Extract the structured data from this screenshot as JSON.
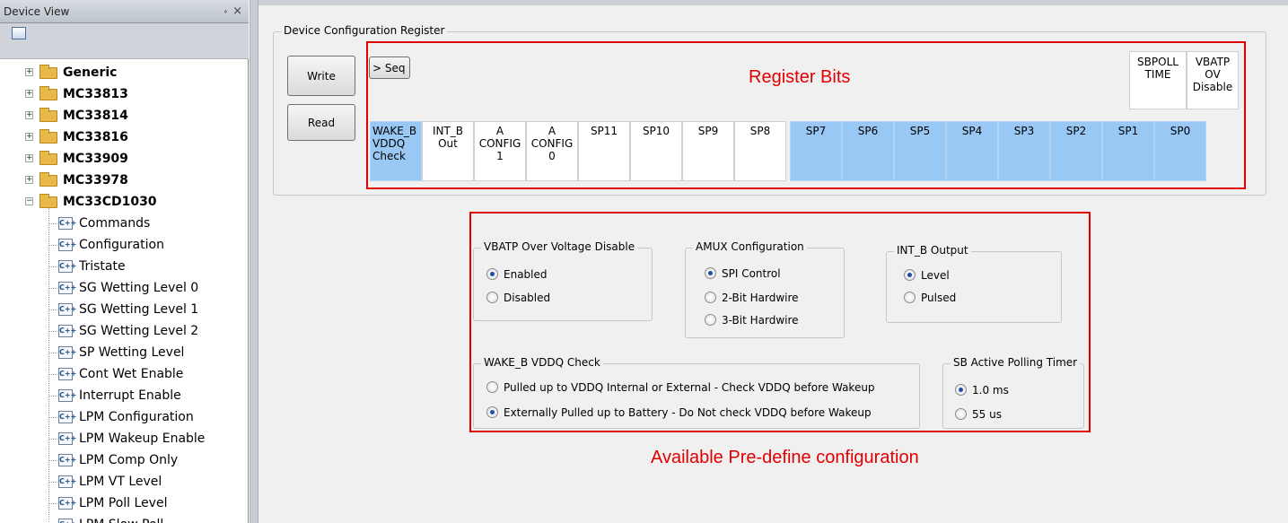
{
  "device_view": {
    "title": "Device View",
    "pin_glyph": "⬫",
    "close_glyph": "×",
    "collapsed_folders": [
      "Generic",
      "MC33813",
      "MC33814",
      "MC33816",
      "MC33909",
      "MC33978"
    ],
    "expanded_folder": "MC33CD1030",
    "children": [
      "Commands",
      "Configuration",
      "Tristate",
      "SG Wetting Level 0",
      "SG Wetting Level 1",
      "SG Wetting Level 2",
      "SP Wetting Level",
      "Cont Wet Enable",
      "Interrupt Enable",
      "LPM Configuration",
      "LPM Wakeup Enable",
      "LPM Comp Only",
      "LPM VT Level",
      "LPM Poll Level",
      "LPM Slow Poll"
    ],
    "plus": "+",
    "minus": "−",
    "cpp_icon_text": "C++"
  },
  "register": {
    "group_title": "Device Configuration Register",
    "write_label": "Write",
    "read_label": "Read",
    "seq_label": "> Seq",
    "register_bits_label": "Register Bits",
    "top_cells": [
      {
        "lines": [
          "SBPOLL",
          "TIME"
        ]
      },
      {
        "lines": [
          "VBATP",
          "OV",
          "Disable"
        ]
      }
    ],
    "bits": [
      {
        "lines": [
          "WAKE_B",
          "VDDQ",
          "Check"
        ],
        "highlight": true
      },
      {
        "lines": [
          "INT_B",
          "Out"
        ],
        "highlight": false
      },
      {
        "lines": [
          "A",
          "CONFIG",
          "1"
        ],
        "highlight": false
      },
      {
        "lines": [
          "A",
          "CONFIG",
          "0"
        ],
        "highlight": false
      },
      {
        "lines": [
          "SP11"
        ],
        "highlight": false
      },
      {
        "lines": [
          "SP10"
        ],
        "highlight": false
      },
      {
        "lines": [
          "SP9"
        ],
        "highlight": false
      },
      {
        "lines": [
          "SP8"
        ],
        "highlight": false
      },
      {
        "lines": [
          "SP7"
        ],
        "highlight": true
      },
      {
        "lines": [
          "SP6"
        ],
        "highlight": true
      },
      {
        "lines": [
          "SP5"
        ],
        "highlight": true
      },
      {
        "lines": [
          "SP4"
        ],
        "highlight": true
      },
      {
        "lines": [
          "SP3"
        ],
        "highlight": true
      },
      {
        "lines": [
          "SP2"
        ],
        "highlight": true
      },
      {
        "lines": [
          "SP1"
        ],
        "highlight": true
      },
      {
        "lines": [
          "SP0"
        ],
        "highlight": true
      }
    ],
    "highlight_color": "#99c8f5"
  },
  "config": {
    "predefined_label": "Available Pre-define configuration",
    "vbatp": {
      "title": "VBATP Over Voltage Disable",
      "options": [
        "Enabled",
        "Disabled"
      ],
      "selected": "Enabled"
    },
    "amux": {
      "title": "AMUX Configuration",
      "options": [
        "SPI Control",
        "2-Bit Hardwire",
        "3-Bit Hardwire"
      ],
      "selected": "SPI Control"
    },
    "intb": {
      "title": "INT_B Output",
      "options": [
        "Level",
        "Pulsed"
      ],
      "selected": "Level"
    },
    "wakeb": {
      "title": "WAKE_B VDDQ Check",
      "options": [
        "Pulled up to VDDQ Internal or External - Check VDDQ before Wakeup",
        "Externally Pulled up to Battery - Do Not check VDDQ before Wakeup"
      ],
      "selected": "Externally Pulled up to Battery - Do Not check VDDQ before Wakeup"
    },
    "sbpoll": {
      "title": "SB Active Polling Timer",
      "options": [
        "1.0 ms",
        "55 us"
      ],
      "selected": "1.0 ms"
    }
  },
  "colors": {
    "annotation_red": "#e00000",
    "radio_dot": "#1c4fa8"
  }
}
